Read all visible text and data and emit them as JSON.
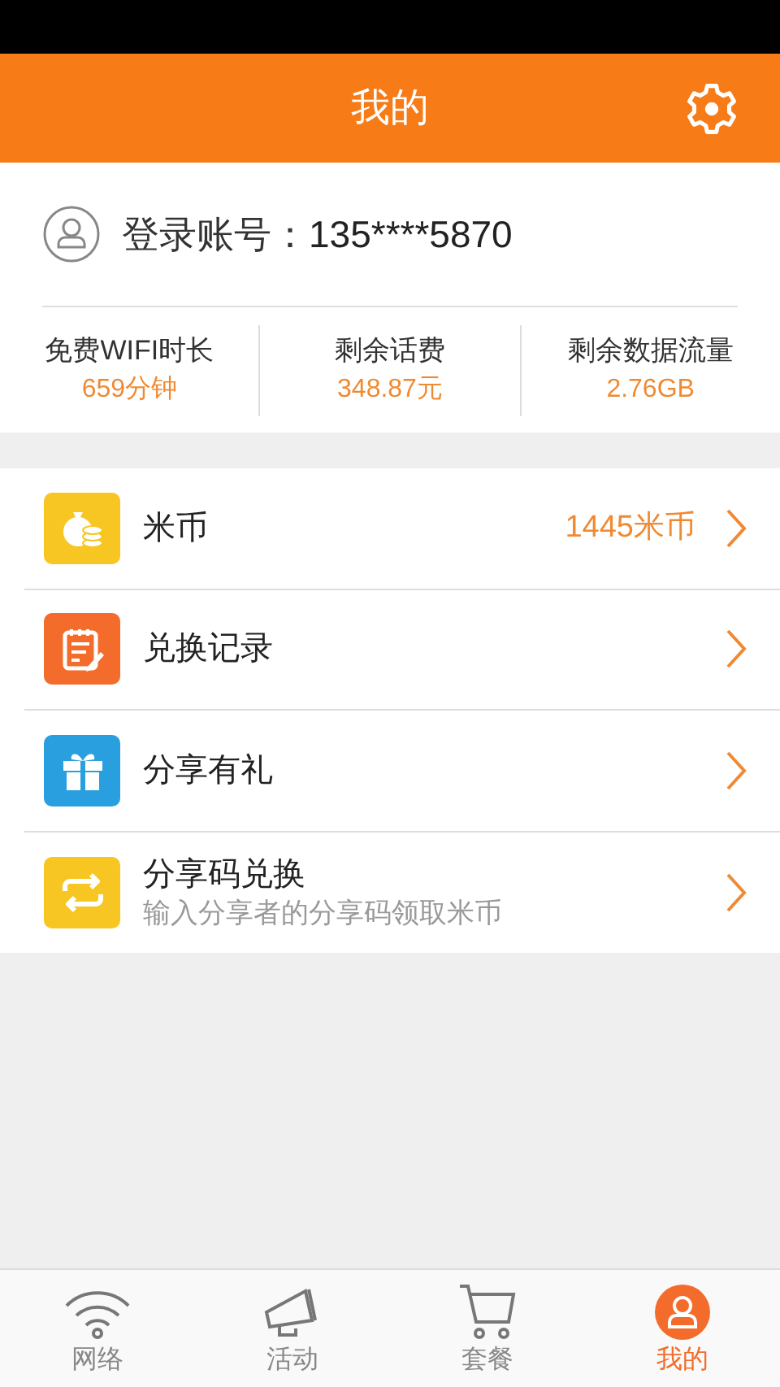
{
  "header": {
    "title": "我的"
  },
  "account": {
    "label": "登录账号：",
    "value": "135****5870"
  },
  "stats": [
    {
      "label": "免费WIFI时长",
      "value": "659分钟"
    },
    {
      "label": "剩余话费",
      "value": "348.87元"
    },
    {
      "label": "剩余数据流量",
      "value": "2.76GB"
    }
  ],
  "menu": [
    {
      "kind": "coins",
      "color": "#f7c623",
      "title": "米币",
      "value": "1445米币"
    },
    {
      "kind": "notes",
      "color": "#f36c2b",
      "title": "兑换记录"
    },
    {
      "kind": "gift",
      "color": "#2a9fe0",
      "title": "分享有礼"
    },
    {
      "kind": "swap",
      "color": "#f7c623",
      "title": "分享码兑换",
      "subtitle": "输入分享者的分享码领取米币"
    }
  ],
  "tabs": [
    {
      "kind": "wifi",
      "label": "网络",
      "selected": false
    },
    {
      "kind": "megaphone",
      "label": "活动",
      "selected": false
    },
    {
      "kind": "cart",
      "label": "套餐",
      "selected": false
    },
    {
      "kind": "user",
      "label": "我的",
      "selected": true
    }
  ]
}
